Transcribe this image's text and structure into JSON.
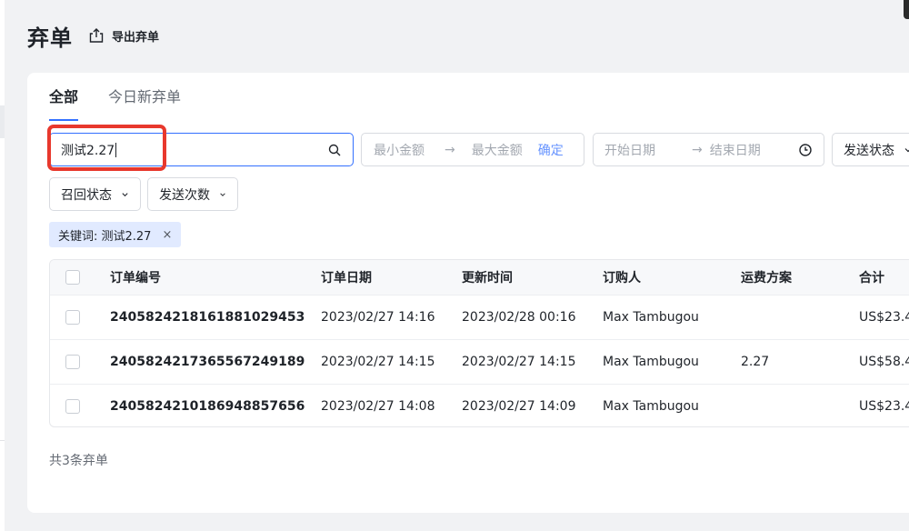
{
  "header": {
    "title": "弃单",
    "export_label": "导出弃单"
  },
  "tabs": [
    {
      "label": "全部",
      "active": true
    },
    {
      "label": "今日新弃单",
      "active": false
    }
  ],
  "filters": {
    "search_value": "测试2.27",
    "min_amount_placeholder": "最小金额",
    "max_amount_placeholder": "最大金额",
    "confirm_label": "确定",
    "start_date_placeholder": "开始日期",
    "end_date_placeholder": "结束日期",
    "send_status_label": "发送状态",
    "recall_status_label": "召回状态",
    "send_count_label": "发送次数",
    "range_arrow": "→"
  },
  "active_filter": {
    "label": "关键词: 测试2.27",
    "remove_glyph": "×"
  },
  "table": {
    "headers": {
      "id": "订单编号",
      "date": "订单日期",
      "updated": "更新时间",
      "buyer": "订购人",
      "shipping": "运费方案",
      "total": "合计"
    },
    "rows": [
      {
        "id": "2405824218161881029453",
        "date": "2023/02/27 14:16",
        "updated": "2023/02/28 00:16",
        "buyer": "Max Tambugou",
        "shipping": "",
        "total": "US$23.4"
      },
      {
        "id": "2405824217365567249189",
        "date": "2023/02/27 14:15",
        "updated": "2023/02/27 14:15",
        "buyer": "Max Tambugou",
        "shipping": "2.27",
        "total": "US$58.4"
      },
      {
        "id": "2405824210186948857656",
        "date": "2023/02/27 14:08",
        "updated": "2023/02/27 14:09",
        "buyer": "Max Tambugou",
        "shipping": "",
        "total": "US$23.4"
      }
    ]
  },
  "footer": {
    "count_label": "共3条弃单"
  },
  "colors": {
    "accent": "#3370ff",
    "highlight": "#e8382d",
    "tag_bg": "#e1eaff"
  },
  "icons": {
    "export": "export-icon",
    "search": "search-icon",
    "clock": "clock-icon",
    "chevron": "chevron-down-icon"
  }
}
